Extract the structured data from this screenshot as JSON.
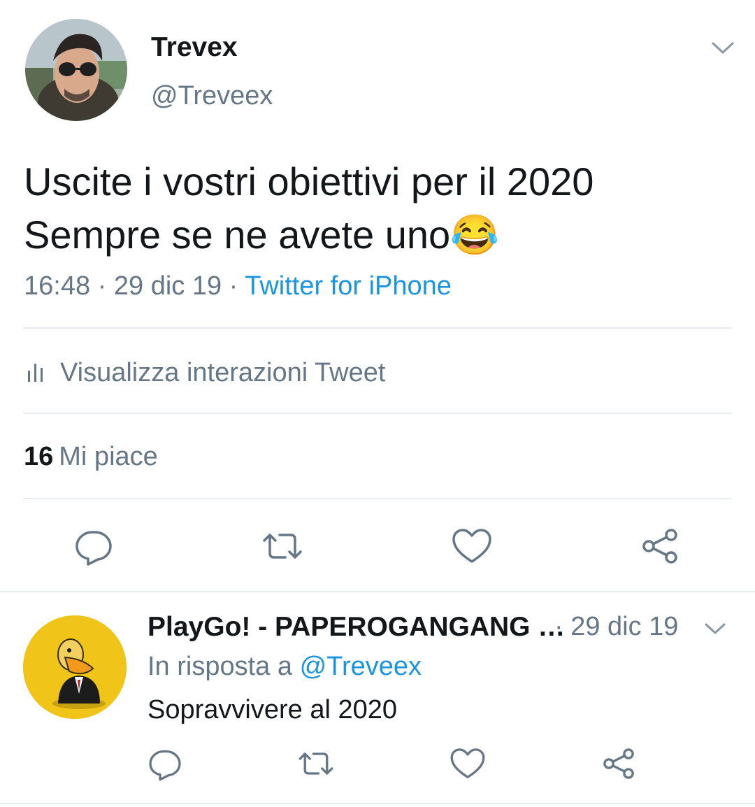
{
  "tweet": {
    "author_name": "Trevex",
    "author_handle": "@Treveex",
    "text_line1": "Uscite i vostri obiettivi per il 2020",
    "text_line2": "Sempre se ne avete uno",
    "emoji": "😂",
    "time": "16:48",
    "date": "29 dic 19",
    "source": "Twitter for iPhone",
    "analytics_label": "Visualizza interazioni Tweet",
    "likes_count": "16",
    "likes_label": "Mi piace"
  },
  "reply": {
    "author_name": "PlayGo! - PAPEROGANGANG …",
    "date": "· 29 dic 19",
    "in_reply_prefix": "In risposta a",
    "in_reply_mention": "@Treveex",
    "text": "Sopravvivere al 2020"
  },
  "icons": [
    "reply-icon",
    "retweet-icon",
    "like-icon",
    "share-icon",
    "analytics-icon",
    "chevron-down-icon"
  ],
  "colors": {
    "link": "#1b95e0",
    "secondary": "#657786",
    "divider": "#e6ecf0",
    "icon": "#657786"
  }
}
